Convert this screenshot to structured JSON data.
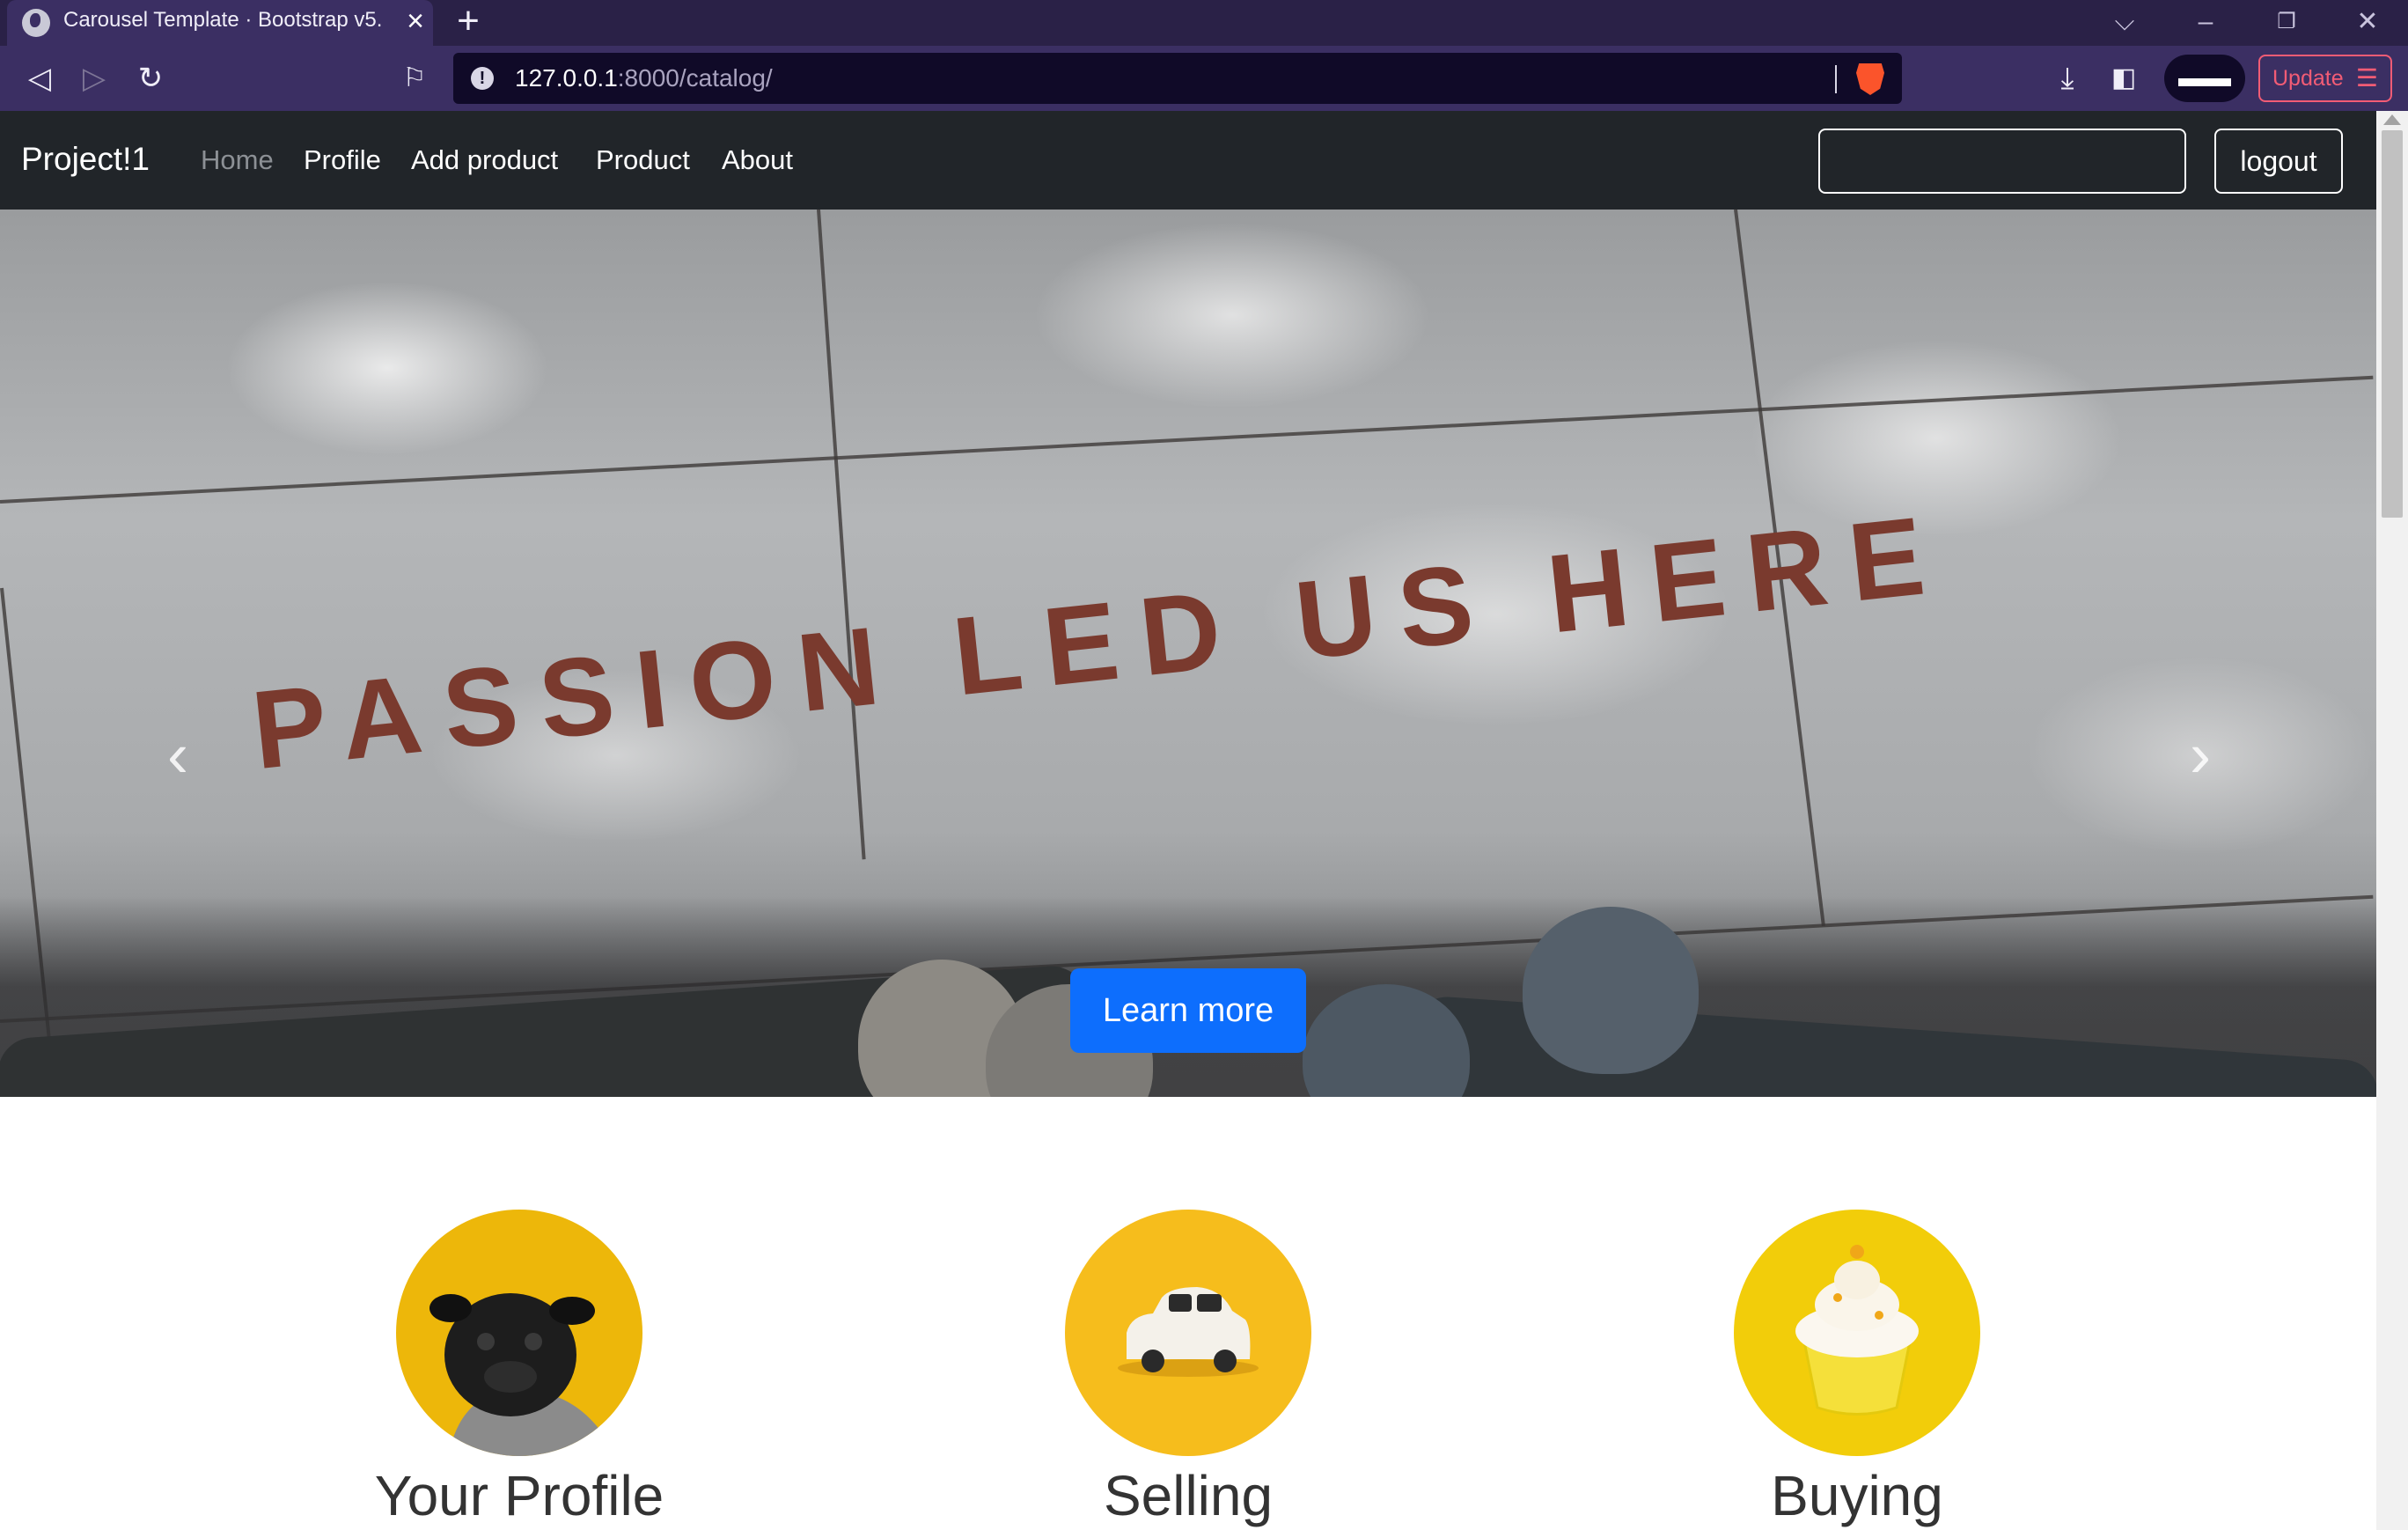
{
  "browser": {
    "tab_title": "Carousel Template · Bootstrap v5.",
    "url_host": "127.0.0.1",
    "url_rest": ":8000/catalog/",
    "update_label": "Update"
  },
  "navbar": {
    "brand": "Project!1",
    "links": [
      {
        "label": "Home",
        "active": true
      },
      {
        "label": "Profile"
      },
      {
        "label": "Add product"
      },
      {
        "label": "Product"
      },
      {
        "label": "About"
      }
    ],
    "search_value": "",
    "logout_label": "logout"
  },
  "carousel": {
    "pavement_text": "PASSION LED US HERE",
    "button_label": "Learn more",
    "slide_count": 3,
    "active_slide": 2
  },
  "features": [
    {
      "title": "Your Profile",
      "image": "pug-dog"
    },
    {
      "title": "Selling",
      "image": "toy-car"
    },
    {
      "title": "Buying",
      "image": "cupcake"
    }
  ],
  "colors": {
    "accent": "#0d6efd",
    "navbar_bg": "#212529",
    "browser_bg": "#3b2f63",
    "feature_bg": "#f2c01e"
  }
}
